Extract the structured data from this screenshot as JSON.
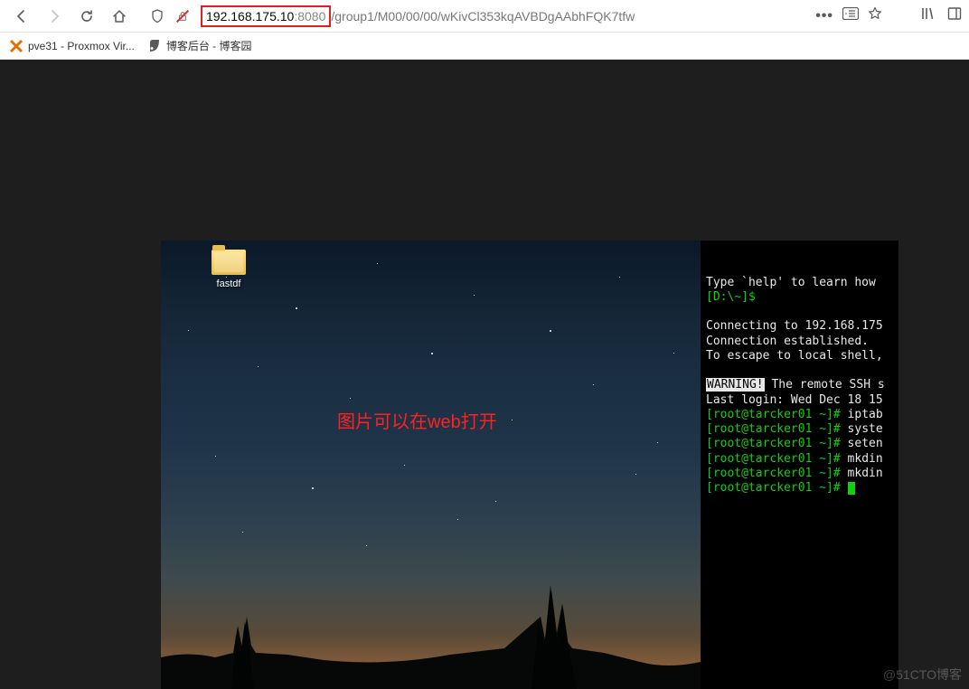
{
  "addressbar": {
    "ip": "192.168.175.10",
    "port": ":8080",
    "path": "/group1/M00/00/00/wKivCl353kqAVBDgAAbhFQK7tfw"
  },
  "bookmarks": {
    "item1": "pve31 - Proxmox Vir...",
    "item2": "博客后台 - 博客园"
  },
  "desktop": {
    "folder_label": "fastdf",
    "caption": "图片可以在web打开"
  },
  "terminal": {
    "line_help": "Type `help' to learn how",
    "prompt_d": "[D:\\~]$",
    "connecting": "Connecting to 192.168.175",
    "conn_est": "Connection established.",
    "escape": "To escape to local shell,",
    "warning_label": "WARNING!",
    "warning_rest": " The remote SSH s",
    "last_login": "Last login: Wed Dec 18 15",
    "root_prompt": "[root@tarcker01 ~]#",
    "cmd_iptab": " iptab",
    "cmd_syste": " syste",
    "cmd_seten": " seten",
    "cmd_mkdin": " mkdin",
    "cmd_empty": " "
  },
  "watermark": "@51CTO博客"
}
